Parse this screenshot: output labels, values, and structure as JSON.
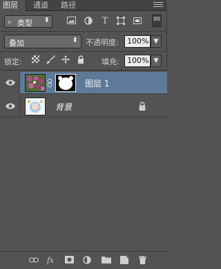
{
  "tabs": [
    {
      "label": "图层",
      "active": true
    },
    {
      "label": "通道",
      "active": false
    },
    {
      "label": "路径",
      "active": false
    }
  ],
  "filter": {
    "kind_label": "类型",
    "icons": [
      "pixel-filter-icon",
      "adjustment-filter-icon",
      "type-filter-icon",
      "shape-filter-icon",
      "smart-object-filter-icon"
    ]
  },
  "blend": {
    "mode": "叠加",
    "opacity_label": "不透明度:",
    "opacity_value": "100%"
  },
  "lock": {
    "label": "锁定:",
    "icons": [
      "lock-transparent-icon",
      "lock-image-icon",
      "lock-position-icon",
      "lock-all-icon"
    ],
    "fill_label": "填充:",
    "fill_value": "100%"
  },
  "layers": [
    {
      "name": "图层 1",
      "selected": true,
      "has_mask": true,
      "visible": true,
      "locked": false
    },
    {
      "name": "背景",
      "selected": false,
      "has_mask": false,
      "visible": true,
      "locked": true
    }
  ],
  "footer": {
    "icons": [
      "link-layers-icon",
      "fx-icon",
      "add-mask-icon",
      "adjustment-layer-icon",
      "group-folder-icon",
      "new-layer-icon",
      "delete-icon"
    ],
    "fx_label": "fx"
  },
  "colors": {
    "panel_bg": "#535353",
    "selected_row": "#5e7a99",
    "field_bg": "#ececec"
  }
}
